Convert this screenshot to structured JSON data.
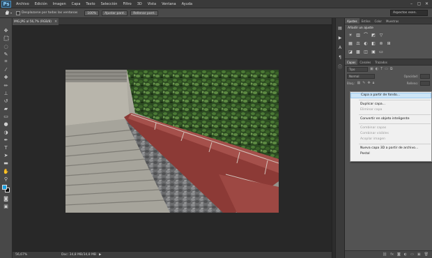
{
  "app": {
    "logo": "Ps"
  },
  "menu": [
    "Archivo",
    "Edición",
    "Imagen",
    "Capa",
    "Texto",
    "Selección",
    "Filtro",
    "3D",
    "Vista",
    "Ventana",
    "Ayuda"
  ],
  "window_controls": [
    "–",
    "▢",
    "✕"
  ],
  "options": {
    "scroll_all_label": "Desplazarse por todas las ventanas",
    "btn_100": "100%",
    "btn_fit": "Ajustar pant.",
    "btn_fill": "Rellenar pant.",
    "workspace": "Aspectos esen."
  },
  "document": {
    "tab_label": "IMG.JPG al 56,7% (RGB/8)",
    "close": "×"
  },
  "status": {
    "zoom": "56,67%",
    "doc_info": "Doc: 34,8 MB/34,8 MB",
    "arrow": "▶"
  },
  "panels": {
    "top_tabs": [
      "Ajustes",
      "Estilos",
      "Color",
      "Muestras"
    ],
    "adjust_title": "Añadir un ajuste",
    "layer_tabs": [
      "Capas",
      "Canales",
      "Trazados"
    ],
    "kind_select": "Tipo",
    "blend_select": "Normal",
    "opacity_label": "Opacidad:",
    "lock_label": "Bloq.:",
    "fill_label": "Relleno:"
  },
  "context_menu": [
    {
      "label": "Capa a partir de fondo...",
      "state": "highlight"
    },
    {
      "sep": true
    },
    {
      "label": "Duplicar capa...",
      "state": "normal"
    },
    {
      "label": "Eliminar capa",
      "state": "disabled"
    },
    {
      "sep": true
    },
    {
      "label": "Convertir en objeto inteligente",
      "state": "normal"
    },
    {
      "sep": true
    },
    {
      "label": "Combinar capas",
      "state": "disabled"
    },
    {
      "label": "Combinar visibles",
      "state": "disabled"
    },
    {
      "label": "Acoplar imagen",
      "state": "disabled"
    },
    {
      "sep": true
    },
    {
      "label": "Nueva capa 3D a partir de archivo...",
      "state": "normal"
    },
    {
      "label": "Postal",
      "state": "normal"
    }
  ],
  "colors": {
    "foreground": "#1a9fe0",
    "background": "#000000",
    "menu_highlight": "#cde5f7"
  }
}
